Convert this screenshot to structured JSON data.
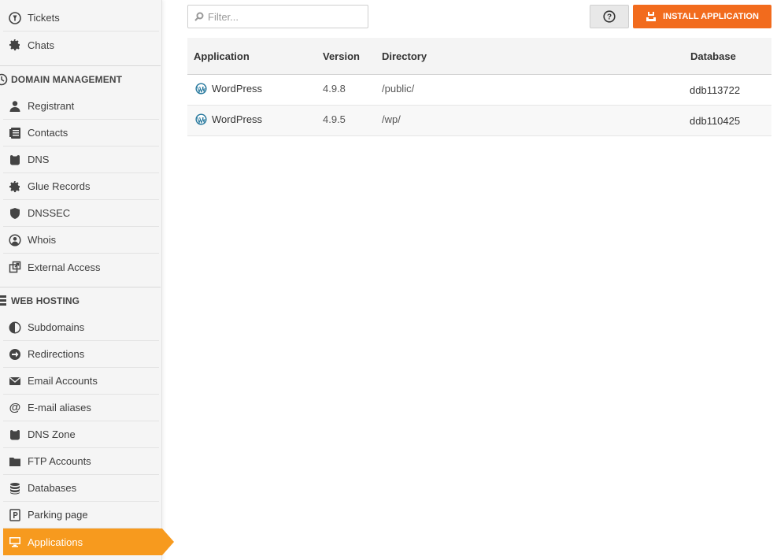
{
  "sidebar": {
    "items_top": [
      {
        "label": "Tickets",
        "icon": "ticket-icon"
      },
      {
        "label": "Chats",
        "icon": "gear-icon"
      }
    ],
    "domain_section": {
      "title": "DOMAIN MANAGEMENT",
      "items": [
        {
          "label": "Registrant",
          "icon": "user-icon"
        },
        {
          "label": "Contacts",
          "icon": "contacts-icon"
        },
        {
          "label": "DNS",
          "icon": "dns-icon"
        },
        {
          "label": "Glue Records",
          "icon": "gear-icon"
        },
        {
          "label": "DNSSEC",
          "icon": "shield-icon"
        },
        {
          "label": "Whois",
          "icon": "user-circle-icon"
        },
        {
          "label": "External Access",
          "icon": "external-icon"
        }
      ]
    },
    "hosting_section": {
      "title": "WEB HOSTING",
      "items": [
        {
          "label": "Subdomains",
          "icon": "half-circle-icon"
        },
        {
          "label": "Redirections",
          "icon": "arrow-circle-icon"
        },
        {
          "label": "Email Accounts",
          "icon": "envelope-icon"
        },
        {
          "label": "E-mail aliases",
          "icon": "at-icon"
        },
        {
          "label": "DNS Zone",
          "icon": "dns-icon"
        },
        {
          "label": "FTP Accounts",
          "icon": "folder-icon"
        },
        {
          "label": "Databases",
          "icon": "database-icon"
        },
        {
          "label": "Parking page",
          "icon": "parking-icon"
        },
        {
          "label": "Applications",
          "icon": "monitor-icon"
        }
      ]
    },
    "active_item": "Applications",
    "accent_color": "#f79a1e"
  },
  "toolbar": {
    "filter_placeholder": "Filter...",
    "filter_value": "",
    "help_label": "?",
    "install_label": "INSTALL APPLICATION",
    "install_color": "#f26b1d"
  },
  "table": {
    "headers": {
      "application": "Application",
      "version": "Version",
      "directory": "Directory",
      "database": "Database"
    },
    "rows": [
      {
        "application": "WordPress",
        "version": "4.9.8",
        "directory": "/public/",
        "database": "ddb113722"
      },
      {
        "application": "WordPress",
        "version": "4.9.5",
        "directory": "/wp/",
        "database": "ddb110425"
      }
    ]
  }
}
